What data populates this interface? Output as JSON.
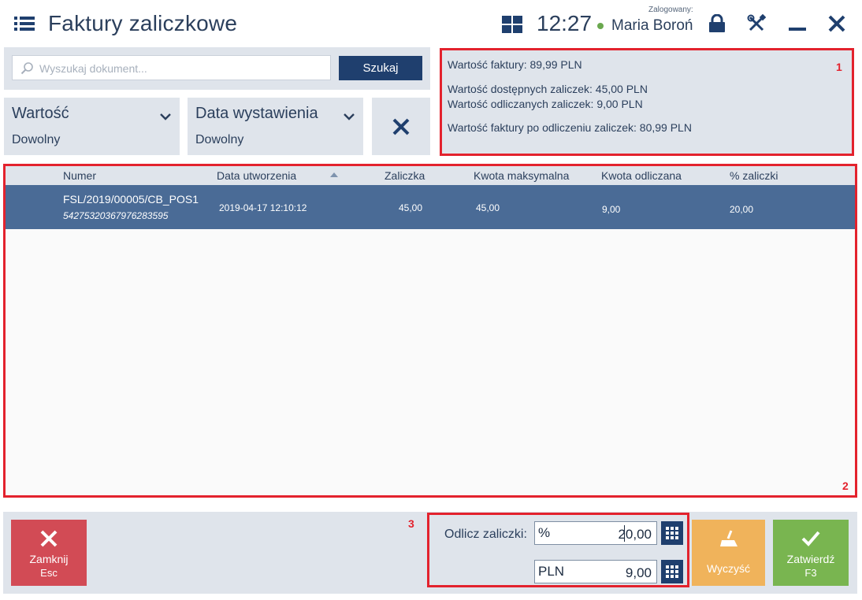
{
  "header": {
    "title": "Faktury zaliczkowe",
    "clock": "12:27",
    "logged_label": "Zalogowany:",
    "user_name": "Maria Boroń",
    "icons": [
      "menu-icon",
      "tiles-icon",
      "lock-icon",
      "tools-icon",
      "minimize-icon",
      "close-icon"
    ]
  },
  "search": {
    "placeholder": "Wyszukaj dokument...",
    "value": "",
    "button_label": "Szukaj"
  },
  "filters": [
    {
      "label": "Wartość",
      "value": "Dowolny"
    },
    {
      "label": "Data wystawienia",
      "value": "Dowolny"
    }
  ],
  "info": {
    "invoice_value": "Wartość faktury: 89,99 PLN",
    "available_advances": "Wartość dostępnych zaliczek: 45,00 PLN",
    "deducted_advances": "Wartość odliczanych zaliczek: 9,00 PLN",
    "value_after": "Wartość faktury po odliczeniu zaliczek: 80,99 PLN"
  },
  "markers": {
    "m1": "1",
    "m2": "2",
    "m3": "3"
  },
  "grid": {
    "columns": [
      "Numer",
      "Data utworzenia",
      "Zaliczka",
      "Kwota maksymalna",
      "Kwota odliczana",
      "% zaliczki"
    ],
    "rows": [
      {
        "number": "FSL/2019/00005/CB_POS1",
        "number_sub": "54275320367976283595",
        "created": "2019-04-17 12:10:12",
        "advance": "45,00",
        "max_amount": "45,00",
        "deducted": "9,00",
        "percent": "20,00"
      }
    ]
  },
  "deduct": {
    "label": "Odlicz zaliczki:",
    "percent_unit": "%",
    "percent_value": "20,00",
    "pln_unit": "PLN",
    "pln_value": "9,00"
  },
  "buttons": {
    "close_label": "Zamknij",
    "close_key": "Esc",
    "clear_label": "Wyczyść",
    "confirm_label": "Zatwierdź",
    "confirm_key": "F3"
  },
  "colors": {
    "accent": "#1f3f6e",
    "selected_row": "#4a6b96",
    "panel": "#dfe4eb",
    "annotation": "#e3222d",
    "close": "#d24b55",
    "clear": "#f0b35b",
    "confirm": "#79b550"
  }
}
